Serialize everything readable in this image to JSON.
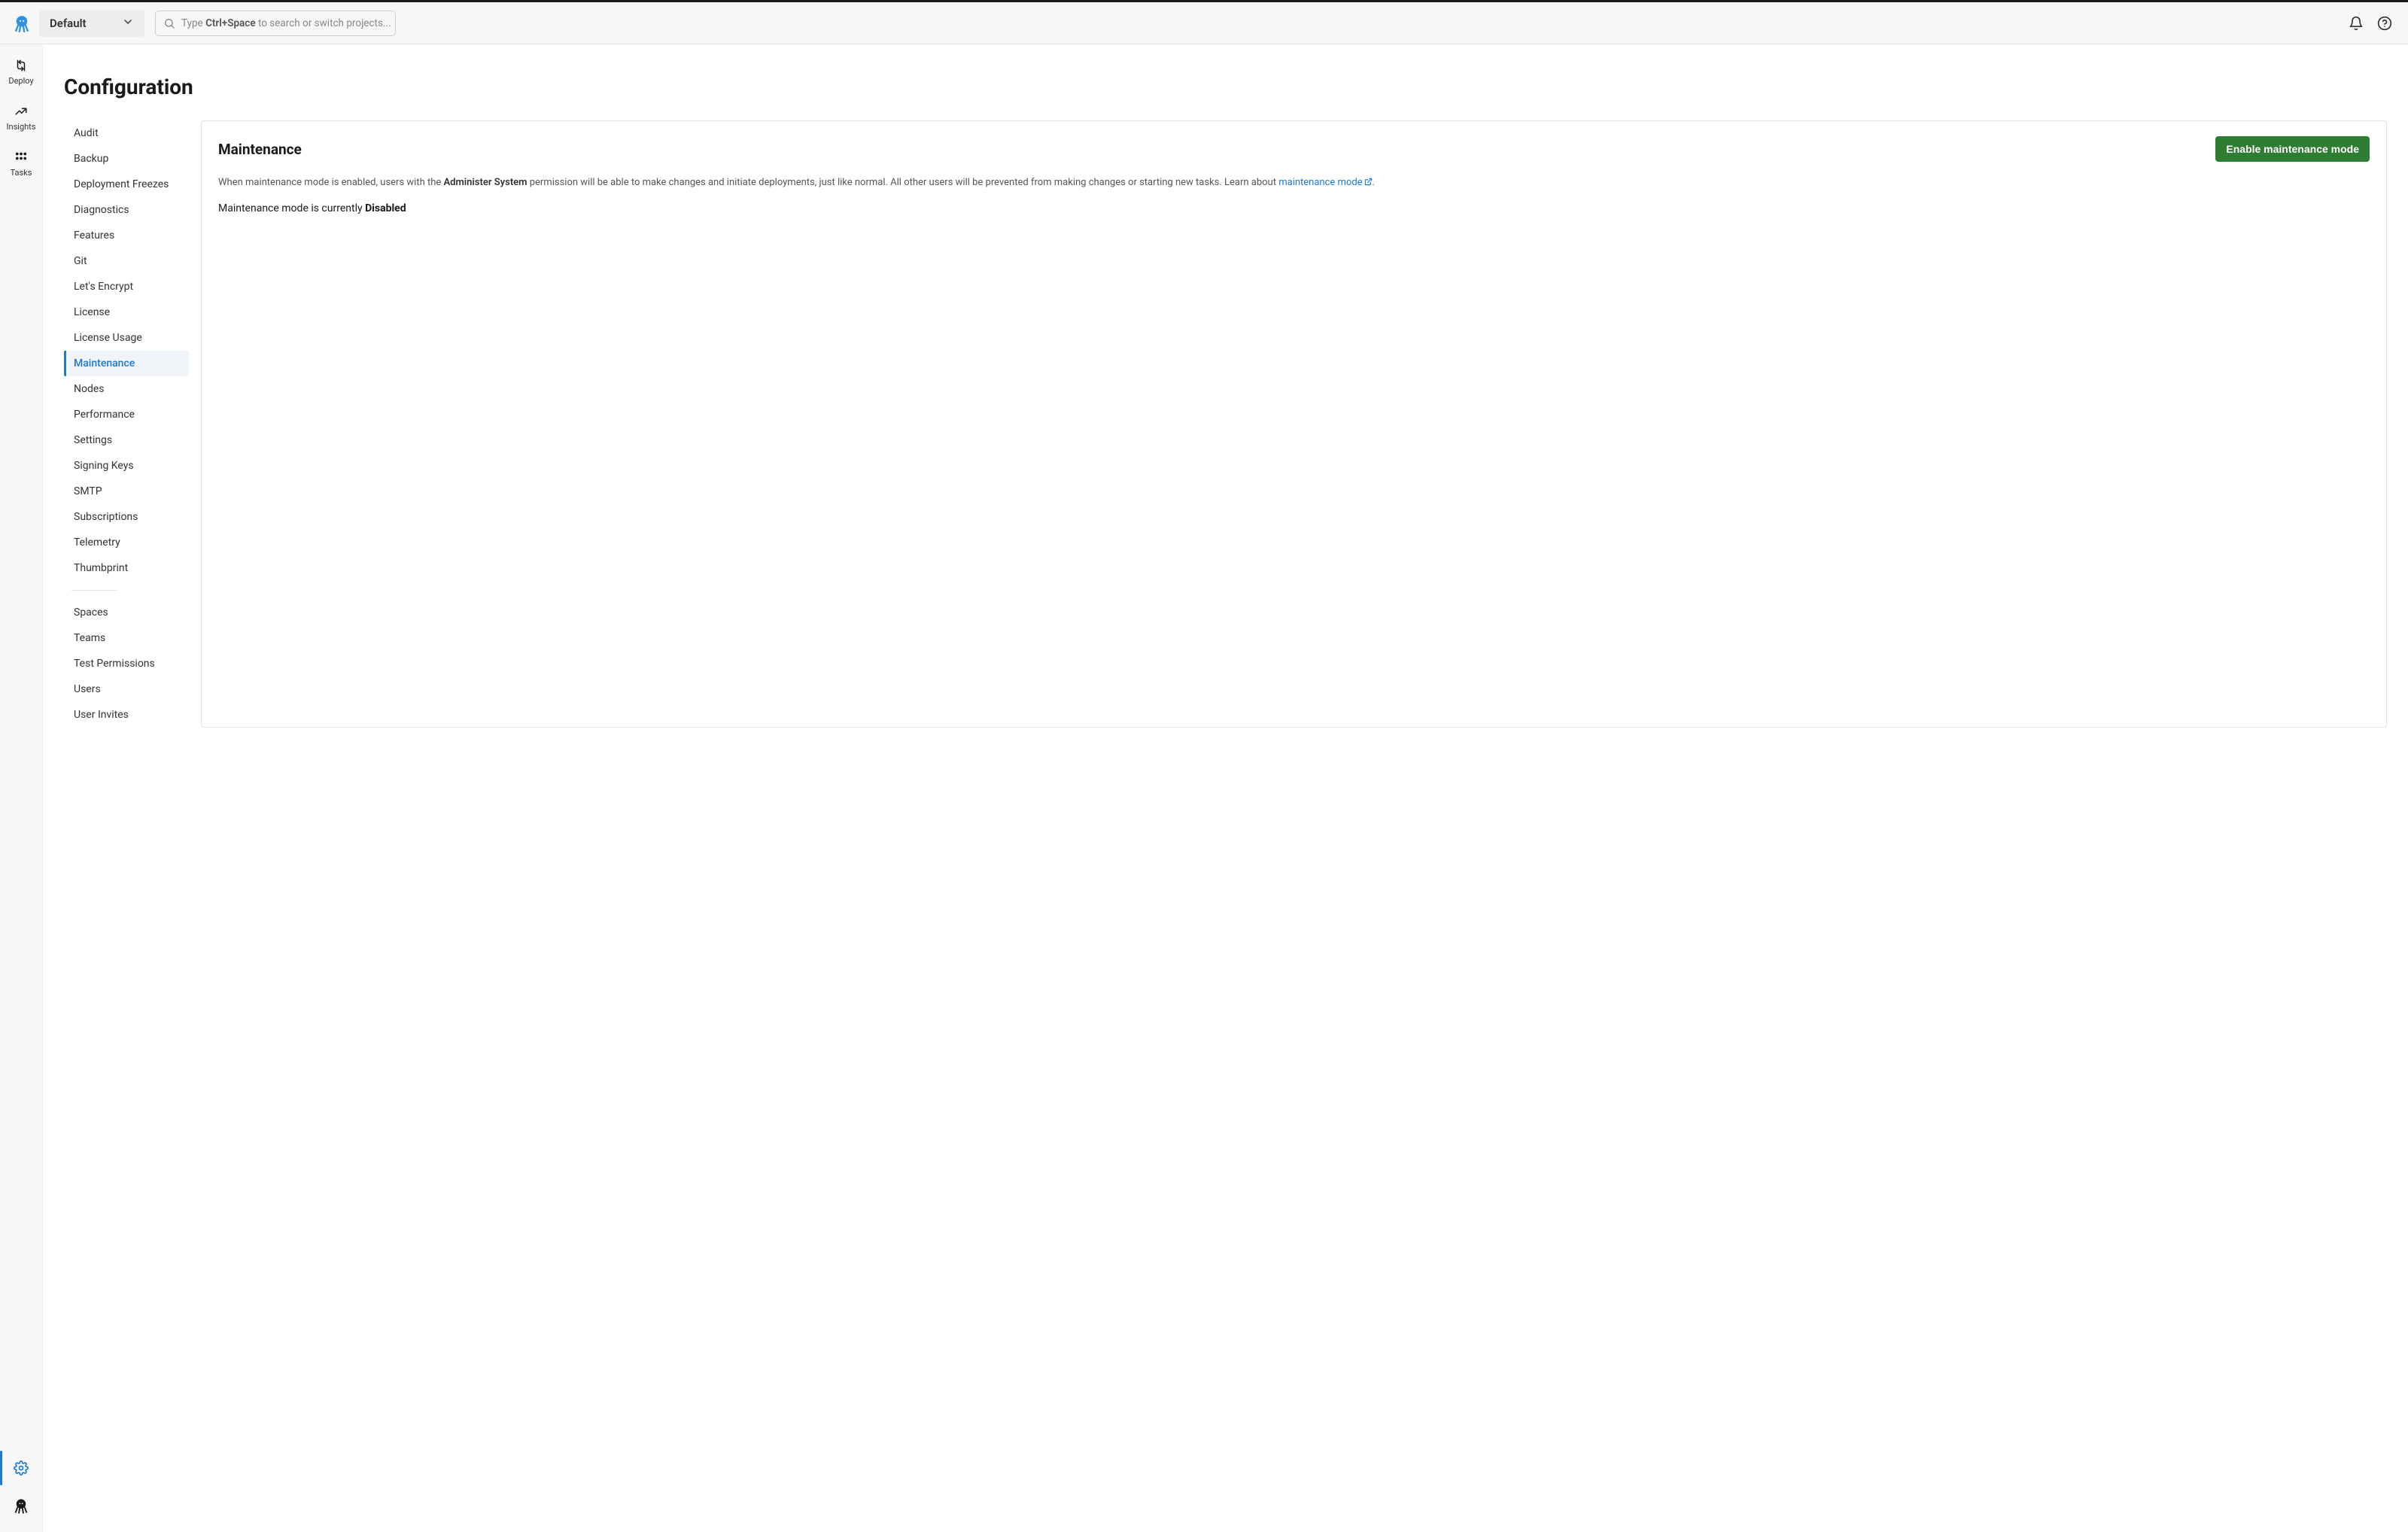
{
  "header": {
    "space_label": "Default",
    "search_prefix": "Type ",
    "search_shortcut": "Ctrl+Space",
    "search_suffix": " to search or switch projects..."
  },
  "rail": {
    "items": [
      {
        "label": "Deploy"
      },
      {
        "label": "Insights"
      },
      {
        "label": "Tasks"
      }
    ]
  },
  "page": {
    "title": "Configuration"
  },
  "config_nav": {
    "group1": [
      "Audit",
      "Backup",
      "Deployment Freezes",
      "Diagnostics",
      "Features",
      "Git",
      "Let's Encrypt",
      "License",
      "License Usage",
      "Maintenance",
      "Nodes",
      "Performance",
      "Settings",
      "Signing Keys",
      "SMTP",
      "Subscriptions",
      "Telemetry",
      "Thumbprint"
    ],
    "group2": [
      "Spaces",
      "Teams",
      "Test Permissions",
      "Users",
      "User Invites"
    ],
    "active_item": "Maintenance"
  },
  "panel": {
    "title": "Maintenance",
    "button_label": "Enable maintenance mode",
    "desc_prefix": "When maintenance mode is enabled, users with the ",
    "desc_bold": "Administer System",
    "desc_mid": " permission will be able to make changes and initiate deployments, just like normal. All other users will be prevented from making changes or starting new tasks. Learn about ",
    "desc_link": "maintenance mode",
    "desc_suffix": ".",
    "status_prefix": "Maintenance mode is currently ",
    "status_value": "Disabled"
  }
}
